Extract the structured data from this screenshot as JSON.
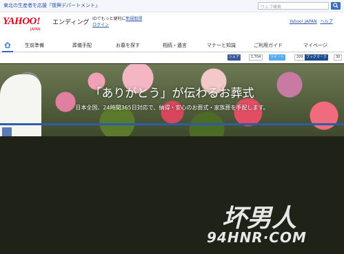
{
  "topbar": {
    "notice": "東北の生産者を応援「復興デパートメント」",
    "search_placeholder": "ウェブ検索"
  },
  "header": {
    "logo": "YAHOO!",
    "logo_sub": "JAPAN",
    "brand": "エンディング",
    "id_text": "IDでもっと便利に",
    "register": "新規取得",
    "login": "ログイン",
    "links": [
      "Yahoo! JAPAN",
      "ヘルプ"
    ]
  },
  "nav": {
    "items": [
      "生前準備",
      "葬儀手配",
      "お墓を探す",
      "相続・遺言",
      "マナーと知識",
      "ご利用ガイド",
      "マイページ"
    ]
  },
  "social": {
    "share_label": "シェア",
    "share_count": "1,704",
    "tweet_label": "ツイート",
    "tweet_count": "209",
    "bookmark_label": "ブックマーク",
    "bookmark_count": "30"
  },
  "hero": {
    "headline": "「ありがとう」が伝わるお葬式",
    "subline": "日本全国、24時間365日対応で、納得・安心のお葬式・家族葬を手配します。"
  },
  "watermark": {
    "text": "坏男人",
    "url": "94HNR·COM"
  },
  "colors": {
    "yahoo_red": "#e0001a",
    "link_blue": "#2a55a8",
    "dark_bg": "#1f2217"
  }
}
